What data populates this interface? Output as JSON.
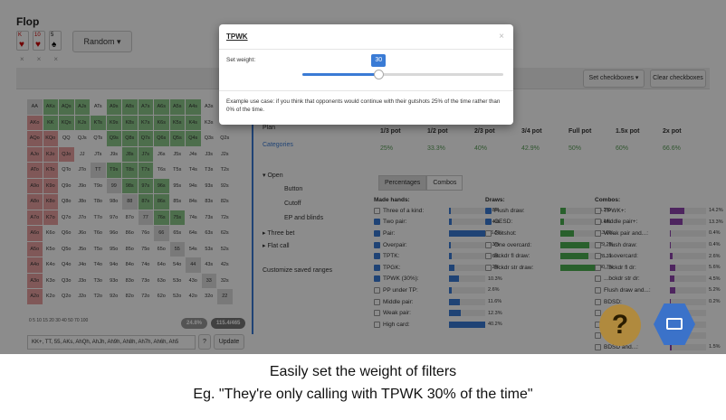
{
  "app": {
    "title": "Flop",
    "cards": [
      {
        "rank": "K",
        "suit": "♥",
        "color": "red"
      },
      {
        "rank": "10",
        "suit": "♥",
        "color": "red"
      },
      {
        "rank": "5",
        "suit": "♠",
        "color": "black"
      }
    ],
    "random_label": "Random ▾",
    "set_checkboxes": "Set checkboxes ▾",
    "clear_checkboxes": "Clear checkboxes"
  },
  "grid": {
    "cells": [
      "AA",
      "AKs",
      "AQs",
      "AJs",
      "ATs",
      "A9s",
      "A8s",
      "A7s",
      "A6s",
      "A5s",
      "A4s",
      "A3s",
      "A2s",
      "AKo",
      "KK",
      "KQs",
      "KJs",
      "KTs",
      "K9s",
      "K8s",
      "K7s",
      "K6s",
      "K5s",
      "K4s",
      "K3s",
      "K2s",
      "AQo",
      "KQo",
      "QQ",
      "QJs",
      "QTs",
      "Q9s",
      "Q8s",
      "Q7s",
      "Q6s",
      "Q5s",
      "Q4s",
      "Q3s",
      "Q2s",
      "AJo",
      "KJo",
      "QJo",
      "JJ",
      "JTs",
      "J9s",
      "J8s",
      "J7s",
      "J6s",
      "J5s",
      "J4s",
      "J3s",
      "J2s",
      "ATo",
      "KTo",
      "QTo",
      "JTo",
      "TT",
      "T9s",
      "T8s",
      "T7s",
      "T6s",
      "T5s",
      "T4s",
      "T3s",
      "T2s",
      "A9o",
      "K9o",
      "Q9o",
      "J9o",
      "T9o",
      "99",
      "98s",
      "97s",
      "96s",
      "95s",
      "94s",
      "93s",
      "92s",
      "A8o",
      "K8o",
      "Q8o",
      "J8o",
      "T8o",
      "98o",
      "88",
      "87s",
      "86s",
      "85s",
      "84s",
      "83s",
      "82s",
      "A7o",
      "K7o",
      "Q7o",
      "J7o",
      "T7o",
      "97o",
      "87o",
      "77",
      "76s",
      "75s",
      "74s",
      "73s",
      "72s",
      "A6o",
      "K6o",
      "Q6o",
      "J6o",
      "T6o",
      "96o",
      "86o",
      "76o",
      "66",
      "65s",
      "64s",
      "63s",
      "62s",
      "A5o",
      "K5o",
      "Q5o",
      "J5o",
      "T5o",
      "95o",
      "85o",
      "75o",
      "65o",
      "55",
      "54s",
      "53s",
      "52s",
      "A4o",
      "K4o",
      "Q4o",
      "J4o",
      "T4o",
      "94o",
      "84o",
      "74o",
      "64o",
      "54o",
      "44",
      "43s",
      "42s",
      "A3o",
      "K3o",
      "Q3o",
      "J3o",
      "T3o",
      "93o",
      "83o",
      "73o",
      "63o",
      "53o",
      "43o",
      "33",
      "32s",
      "A2o",
      "K2o",
      "Q2o",
      "J2o",
      "T2o",
      "92o",
      "82o",
      "72o",
      "62o",
      "52o",
      "42o",
      "32o",
      "22"
    ],
    "stat_combos_pct": "24.8%",
    "stat_combos_count": "115.4/465",
    "range_text": "KK+, TT, 55, AKs, AhQh, AhJh, Ah9h, Ah8h, Ah7h, Ah6h, Ah5",
    "help_q": "?",
    "update_label": "Update",
    "scale": "0   5  10  15  20  30  40  50  70  100"
  },
  "sidebar": {
    "plan": "Plan",
    "categories": "Categories",
    "open": "Open",
    "button": "Button",
    "cutoff": "Cutoff",
    "ep": "EP and blinds",
    "three_bet": "Three bet",
    "flat_call": "Flat call",
    "customize": "Customize saved ranges"
  },
  "bet_table": {
    "headers": [
      "1/3 pot",
      "1/2 pot",
      "2/3 pot",
      "3/4 pot",
      "Full pot",
      "1.5x pot",
      "2x pot"
    ],
    "values": [
      "25%",
      "33.3%",
      "40%",
      "42.9%",
      "50%",
      "60%",
      "66.6%"
    ]
  },
  "tabs": [
    "Percentages",
    "Combos"
  ],
  "made_hands": {
    "title": "Made hands:",
    "items": [
      {
        "label": "Three of a kind:",
        "pct": "1.8%",
        "frac": 0.05,
        "on": false
      },
      {
        "label": "Two pair:",
        "pct": "2.4%",
        "frac": 0.07,
        "on": true
      },
      {
        "label": "Pair:",
        "pct": "56.5%",
        "frac": 1,
        "on": true
      },
      {
        "label": "Overpair:",
        "pct": "1.3%",
        "frac": 0.04,
        "on": true
      },
      {
        "label": "TPTK:",
        "pct": "2.6%",
        "frac": 0.07,
        "on": true
      },
      {
        "label": "TPGK:",
        "pct": "5.2%",
        "frac": 0.14,
        "on": true
      },
      {
        "label": "TPWK (30%):",
        "pct": "10.3%",
        "frac": 0.28,
        "on": true
      },
      {
        "label": "PP under TP:",
        "pct": "2.6%",
        "frac": 0.07,
        "on": false
      },
      {
        "label": "Middle pair:",
        "pct": "11.6%",
        "frac": 0.31,
        "on": false
      },
      {
        "label": "Weak pair:",
        "pct": "12.3%",
        "frac": 0.33,
        "on": false
      },
      {
        "label": "High card:",
        "pct": "40.2%",
        "frac": 1,
        "on": false
      }
    ]
  },
  "draws": {
    "title": "Draws:",
    "items": [
      {
        "label": "Flush draw:",
        "pct": "5.2%",
        "frac": 0.14,
        "on": true
      },
      {
        "label": "OESD:",
        "pct": "3.4%",
        "frac": 0.09,
        "on": true
      },
      {
        "label": "Gutshot:",
        "pct": "13.6%",
        "frac": 0.37,
        "on": false
      },
      {
        "label": "One overcard:",
        "pct": "29.2%",
        "frac": 0.8,
        "on": false
      },
      {
        "label": "Bckdr fl draw:",
        "pct": "28.3%",
        "frac": 0.78,
        "on": false
      },
      {
        "label": "Bckdr str draw:",
        "pct": "40.7%",
        "frac": 1,
        "on": false
      }
    ]
  },
  "combos": {
    "title": "Combos:",
    "items": [
      {
        "label": "TPWK+:",
        "pct": "14.2%",
        "frac": 0.39,
        "on": false
      },
      {
        "label": "Middle pair+:",
        "pct": "13.3%",
        "frac": 0.36,
        "on": false
      },
      {
        "label": "Weak pair and...:",
        "pct": "0.4%",
        "frac": 0.01,
        "on": false
      },
      {
        "label": "...flush draw:",
        "pct": "0.4%",
        "frac": 0.01,
        "on": false
      },
      {
        "label": "...1 overcard:",
        "pct": "2.6%",
        "frac": 0.07,
        "on": false
      },
      {
        "label": "...bckdr fl dr:",
        "pct": "5.6%",
        "frac": 0.15,
        "on": false
      },
      {
        "label": "...bckdr str dr:",
        "pct": "4.5%",
        "frac": 0.12,
        "on": false
      },
      {
        "label": "Flush draw and...:",
        "pct": "5.2%",
        "frac": 0.14,
        "on": false
      },
      {
        "label": "BDSD:",
        "pct": "0.2%",
        "frac": 0.01,
        "on": false
      },
      {
        "label": "...pot:",
        "pct": "",
        "frac": 0,
        "on": false
      },
      {
        "label": "...card:",
        "pct": "",
        "frac": 0,
        "on": false
      },
      {
        "label": "...dr:",
        "pct": "",
        "frac": 0,
        "on": false
      },
      {
        "label": "BDSD and...:",
        "pct": "1.5%",
        "frac": 0.04,
        "on": false
      }
    ]
  },
  "modal": {
    "title": "TPWK",
    "close": "×",
    "weight_label": "Set weight:",
    "weight_value": "30",
    "weight_frac": 0.38,
    "help": "Example use case: if you think that opponents would continue with their gutshots 25% of the time rather than 0% of the time."
  },
  "caption": {
    "line1": "Easily set the weight of filters",
    "line2": "Eg. \"They're only calling with TPWK 30% of the time\""
  }
}
